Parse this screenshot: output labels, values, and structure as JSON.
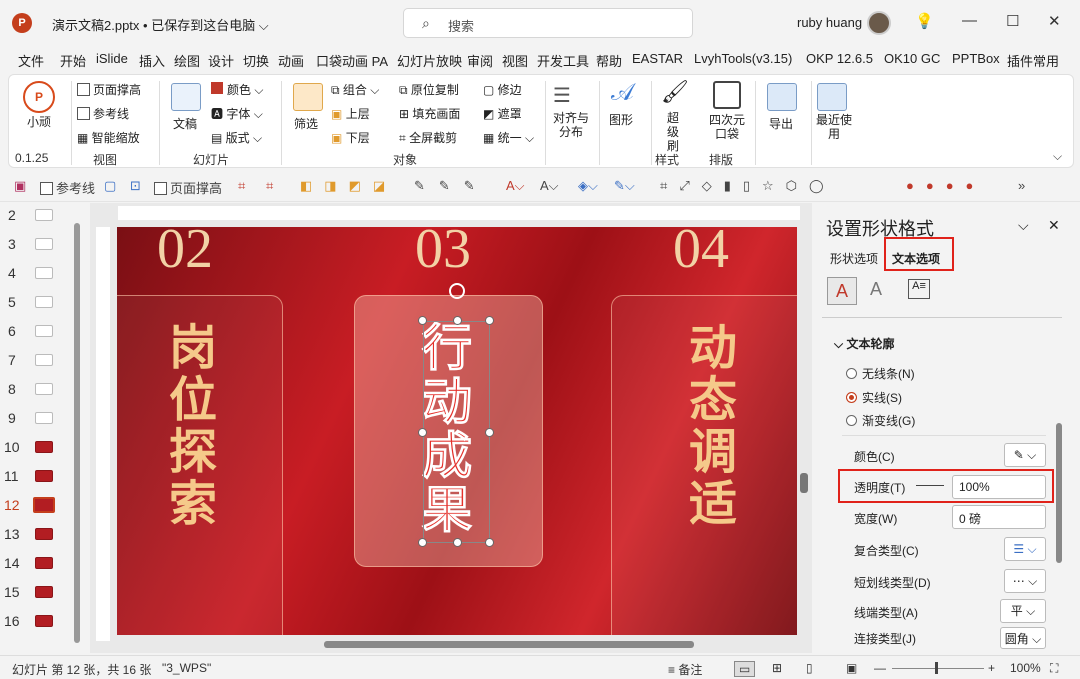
{
  "titlebar": {
    "logo": "P",
    "doc_title": "演示文稿2.pptx • 已保存到这台电脑 ⌵",
    "search_placeholder": "搜索",
    "user": "ruby huang",
    "min": "—",
    "max": "☐",
    "close": "✕",
    "lightbulb": "💡"
  },
  "tabs": [
    "文件",
    "开始",
    "iSlide",
    "插入",
    "绘图",
    "设计",
    "切换",
    "动画",
    "口袋动画 PA",
    "幻灯片放映",
    "审阅",
    "视图",
    "开发工具",
    "帮助",
    "EASTAR",
    "LvyhTools(v3.15)",
    "OKP 12.6.5",
    "OK10 GC",
    "PPTBox",
    "插件常用"
  ],
  "ribbon": {
    "xiaowan": "小顽",
    "version": "0.1.25",
    "view": {
      "items": [
        "页面撑高",
        "参考线",
        "智能缩放"
      ],
      "label": "视图"
    },
    "slide": {
      "doc": "文稿",
      "items": [
        "颜色",
        "字体",
        "版式"
      ],
      "label": "幻灯片"
    },
    "object": {
      "filter": "筛选",
      "col1": [
        "组合",
        "上层",
        "下层"
      ],
      "col2": [
        "原位复制",
        "填充画面",
        "全屏截剪"
      ],
      "col3": [
        "修边",
        "遮罩",
        "统一"
      ],
      "label": "对象"
    },
    "align": "对齐与分布",
    "shape": "图形",
    "style": {
      "item": "超级刷",
      "label": "样式"
    },
    "layout": {
      "item": "四次元口袋",
      "label": "排版"
    },
    "export": "导出",
    "recent": "最近使用"
  },
  "qat": {
    "ref": "参考线",
    "page": "页面撑高"
  },
  "thumbs": [
    "2",
    "3",
    "4",
    "5",
    "6",
    "7",
    "8",
    "9",
    "10",
    "11",
    "12",
    "13",
    "14",
    "15",
    "16"
  ],
  "slide": {
    "nums": [
      "02",
      "03",
      "04"
    ],
    "texts": [
      "岗位探索",
      "行动成果",
      "动态调适"
    ]
  },
  "pane": {
    "title": "设置形状格式",
    "tab_shape": "形状选项",
    "tab_text": "文本选项",
    "section": "文本轮廓",
    "radios": [
      "无线条(N)",
      "实线(S)",
      "渐变线(G)"
    ],
    "color": "颜色(C)",
    "transparency": "透明度(T)",
    "transparency_val": "100%",
    "width": "宽度(W)",
    "width_val": "0 磅",
    "compound": "复合类型(C)",
    "dash": "短划线类型(D)",
    "cap": "线端类型(A)",
    "cap_val": "平",
    "join": "连接类型(J)",
    "join_val": "圆角"
  },
  "status": {
    "slide_info": "幻灯片 第 12 张，共 16 张",
    "theme": "\"3_WPS\"",
    "notes": "备注",
    "zoom": "100%"
  }
}
